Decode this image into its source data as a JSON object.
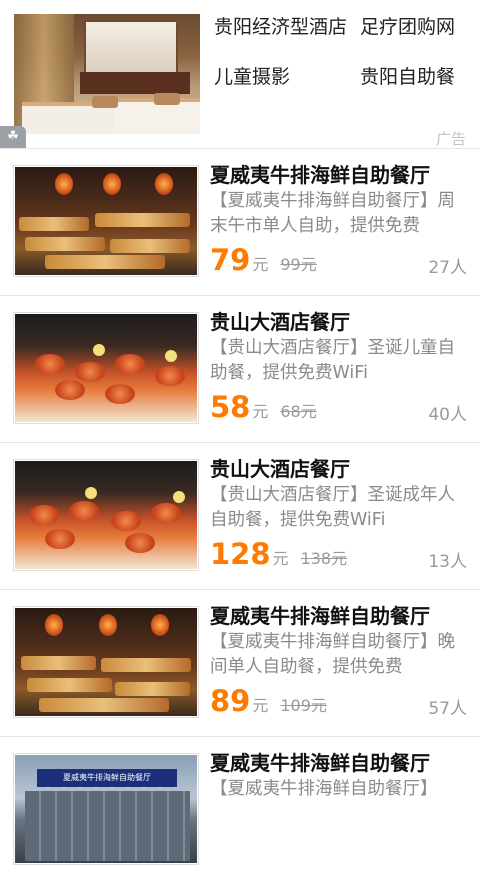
{
  "ad": {
    "links": [
      "贵阳经济型酒店",
      "足疗团购网",
      "儿童摄影",
      "贵阳自助餐"
    ],
    "tag": "广告",
    "badge_icon": "paw-icon"
  },
  "deals": [
    {
      "title": "夏威夷牛排海鲜自助餐厅",
      "desc": "【夏威夷牛排海鲜自助餐厅】周末午市单人自助，提供免费",
      "price": "79",
      "unit": "元",
      "original": "99元",
      "sold": "27人",
      "image": "buffet"
    },
    {
      "title": "贵山大酒店餐厅",
      "desc": "【贵山大酒店餐厅】圣诞儿童自助餐，提供免费WiFi",
      "price": "58",
      "unit": "元",
      "original": "68元",
      "sold": "40人",
      "image": "seafood"
    },
    {
      "title": "贵山大酒店餐厅",
      "desc": "【贵山大酒店餐厅】圣诞成年人自助餐，提供免费WiFi",
      "price": "128",
      "unit": "元",
      "original": "138元",
      "sold": "13人",
      "image": "seafood"
    },
    {
      "title": "夏威夷牛排海鲜自助餐厅",
      "desc": "【夏威夷牛排海鲜自助餐厅】晚间单人自助餐，提供免费",
      "price": "89",
      "unit": "元",
      "original": "109元",
      "sold": "57人",
      "image": "buffet"
    },
    {
      "title": "夏威夷牛排海鲜自助餐厅",
      "desc": "【夏威夷牛排海鲜自助餐厅】",
      "price": "",
      "unit": "",
      "original": "",
      "sold": "",
      "image": "storefront",
      "storefront_sign": "夏威夷牛排海鲜自助餐厅"
    }
  ],
  "colors": {
    "price": "#ff7a00",
    "muted": "#9a9a9a",
    "title": "#111111"
  }
}
